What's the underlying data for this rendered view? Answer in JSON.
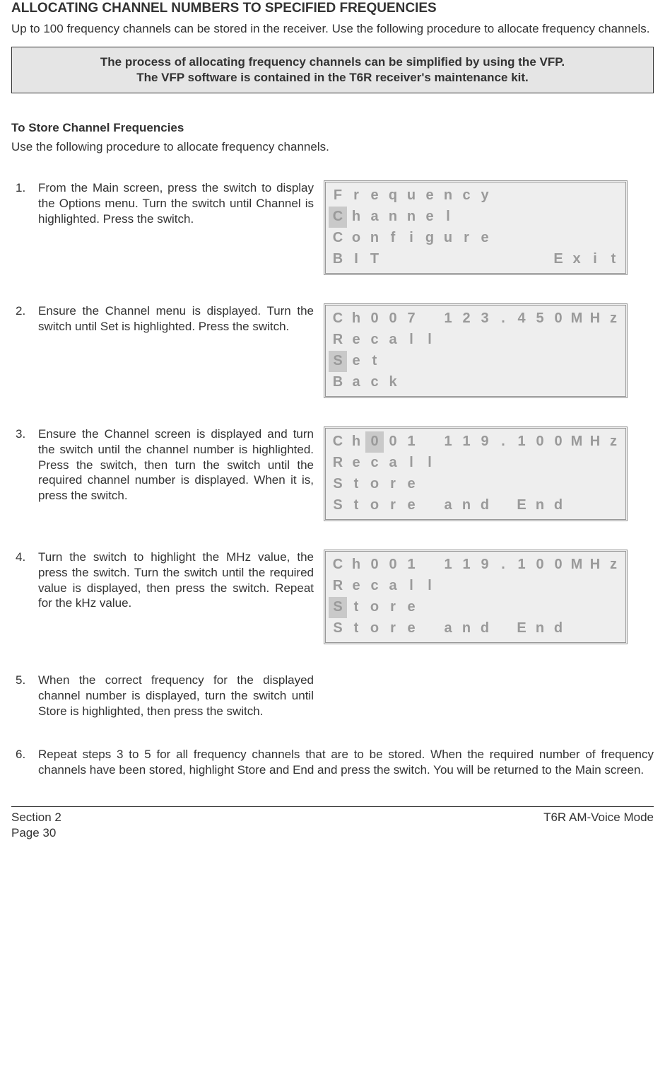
{
  "heading": "ALLOCATING CHANNEL NUMBERS TO SPECIFIED FREQUENCIES",
  "intro": "Up to 100 frequency channels can be stored in the receiver. Use the following procedure to allocate frequency channels.",
  "note": {
    "line1": "The process of allocating frequency channels can be simplified by using the VFP.",
    "line2": "The VFP software is contained in the T6R receiver's maintenance kit."
  },
  "sub_heading": "To Store Channel Frequencies",
  "sub_text": "Use the following procedure to allocate frequency channels.",
  "steps": [
    {
      "text": "From the Main screen, press the switch to display the Options menu. Turn the switch until Channel is highlighted. Press the switch.",
      "lcd": [
        {
          "cells": [
            {
              "c": "F"
            },
            {
              "c": "r"
            },
            {
              "c": "e"
            },
            {
              "c": "q"
            },
            {
              "c": "u"
            },
            {
              "c": "e"
            },
            {
              "c": "n"
            },
            {
              "c": "c"
            },
            {
              "c": "y"
            },
            {
              "c": ""
            },
            {
              "c": ""
            },
            {
              "c": ""
            },
            {
              "c": ""
            },
            {
              "c": ""
            },
            {
              "c": ""
            },
            {
              "c": ""
            }
          ]
        },
        {
          "cells": [
            {
              "c": "C",
              "hl": true
            },
            {
              "c": "h"
            },
            {
              "c": "a"
            },
            {
              "c": "n"
            },
            {
              "c": "n"
            },
            {
              "c": "e"
            },
            {
              "c": "l"
            },
            {
              "c": ""
            },
            {
              "c": ""
            },
            {
              "c": ""
            },
            {
              "c": ""
            },
            {
              "c": ""
            },
            {
              "c": ""
            },
            {
              "c": ""
            },
            {
              "c": ""
            },
            {
              "c": ""
            }
          ]
        },
        {
          "cells": [
            {
              "c": "C"
            },
            {
              "c": "o"
            },
            {
              "c": "n"
            },
            {
              "c": "f"
            },
            {
              "c": "i"
            },
            {
              "c": "g"
            },
            {
              "c": "u"
            },
            {
              "c": "r"
            },
            {
              "c": "e"
            },
            {
              "c": ""
            },
            {
              "c": ""
            },
            {
              "c": ""
            },
            {
              "c": ""
            },
            {
              "c": ""
            },
            {
              "c": ""
            },
            {
              "c": ""
            }
          ]
        },
        {
          "cells": [
            {
              "c": "B"
            },
            {
              "c": "I"
            },
            {
              "c": "T"
            },
            {
              "c": ""
            },
            {
              "c": ""
            },
            {
              "c": ""
            },
            {
              "c": ""
            },
            {
              "c": ""
            },
            {
              "c": ""
            },
            {
              "c": ""
            },
            {
              "c": ""
            },
            {
              "c": ""
            },
            {
              "c": "E"
            },
            {
              "c": "x"
            },
            {
              "c": "i"
            },
            {
              "c": "t"
            }
          ]
        }
      ]
    },
    {
      "text": "Ensure the Channel menu is displayed. Turn the switch until Set is highlighted. Press the switch.",
      "lcd": [
        {
          "cells": [
            {
              "c": "C"
            },
            {
              "c": "h"
            },
            {
              "c": "0"
            },
            {
              "c": "0"
            },
            {
              "c": "7"
            },
            {
              "c": ""
            },
            {
              "c": "1"
            },
            {
              "c": "2"
            },
            {
              "c": "3"
            },
            {
              "c": "."
            },
            {
              "c": "4"
            },
            {
              "c": "5"
            },
            {
              "c": "0"
            },
            {
              "c": "M"
            },
            {
              "c": "H"
            },
            {
              "c": "z"
            }
          ]
        },
        {
          "cells": [
            {
              "c": "R"
            },
            {
              "c": "e"
            },
            {
              "c": "c"
            },
            {
              "c": "a"
            },
            {
              "c": "l"
            },
            {
              "c": "l"
            },
            {
              "c": ""
            },
            {
              "c": ""
            },
            {
              "c": ""
            },
            {
              "c": ""
            },
            {
              "c": ""
            },
            {
              "c": ""
            },
            {
              "c": ""
            },
            {
              "c": ""
            },
            {
              "c": ""
            },
            {
              "c": ""
            }
          ]
        },
        {
          "cells": [
            {
              "c": "S",
              "hl": true
            },
            {
              "c": "e"
            },
            {
              "c": "t"
            },
            {
              "c": ""
            },
            {
              "c": ""
            },
            {
              "c": ""
            },
            {
              "c": ""
            },
            {
              "c": ""
            },
            {
              "c": ""
            },
            {
              "c": ""
            },
            {
              "c": ""
            },
            {
              "c": ""
            },
            {
              "c": ""
            },
            {
              "c": ""
            },
            {
              "c": ""
            },
            {
              "c": ""
            }
          ]
        },
        {
          "cells": [
            {
              "c": "B"
            },
            {
              "c": "a"
            },
            {
              "c": "c"
            },
            {
              "c": "k"
            },
            {
              "c": ""
            },
            {
              "c": ""
            },
            {
              "c": ""
            },
            {
              "c": ""
            },
            {
              "c": ""
            },
            {
              "c": ""
            },
            {
              "c": ""
            },
            {
              "c": ""
            },
            {
              "c": ""
            },
            {
              "c": ""
            },
            {
              "c": ""
            },
            {
              "c": ""
            }
          ]
        }
      ]
    },
    {
      "text": "Ensure the Channel screen is displayed and turn the switch until the channel number is highlighted. Press the switch, then turn the switch until the required channel number is displayed. When it is, press the switch.",
      "lcd": [
        {
          "cells": [
            {
              "c": "C"
            },
            {
              "c": "h"
            },
            {
              "c": "0",
              "hl": true
            },
            {
              "c": "0"
            },
            {
              "c": "1"
            },
            {
              "c": ""
            },
            {
              "c": "1"
            },
            {
              "c": "1"
            },
            {
              "c": "9"
            },
            {
              "c": "."
            },
            {
              "c": "1"
            },
            {
              "c": "0"
            },
            {
              "c": "0"
            },
            {
              "c": "M"
            },
            {
              "c": "H"
            },
            {
              "c": "z"
            }
          ]
        },
        {
          "cells": [
            {
              "c": "R"
            },
            {
              "c": "e"
            },
            {
              "c": "c"
            },
            {
              "c": "a"
            },
            {
              "c": "l"
            },
            {
              "c": "l"
            },
            {
              "c": ""
            },
            {
              "c": ""
            },
            {
              "c": ""
            },
            {
              "c": ""
            },
            {
              "c": ""
            },
            {
              "c": ""
            },
            {
              "c": ""
            },
            {
              "c": ""
            },
            {
              "c": ""
            },
            {
              "c": ""
            }
          ]
        },
        {
          "cells": [
            {
              "c": "S"
            },
            {
              "c": "t"
            },
            {
              "c": "o"
            },
            {
              "c": "r"
            },
            {
              "c": "e"
            },
            {
              "c": ""
            },
            {
              "c": ""
            },
            {
              "c": ""
            },
            {
              "c": ""
            },
            {
              "c": ""
            },
            {
              "c": ""
            },
            {
              "c": ""
            },
            {
              "c": ""
            },
            {
              "c": ""
            },
            {
              "c": ""
            },
            {
              "c": ""
            }
          ]
        },
        {
          "cells": [
            {
              "c": "S"
            },
            {
              "c": "t"
            },
            {
              "c": "o"
            },
            {
              "c": "r"
            },
            {
              "c": "e"
            },
            {
              "c": ""
            },
            {
              "c": "a"
            },
            {
              "c": "n"
            },
            {
              "c": "d"
            },
            {
              "c": ""
            },
            {
              "c": "E"
            },
            {
              "c": "n"
            },
            {
              "c": "d"
            },
            {
              "c": ""
            },
            {
              "c": ""
            },
            {
              "c": ""
            }
          ]
        }
      ]
    },
    {
      "text": "Turn the switch to highlight the MHz value, the press the switch. Turn the switch until the required value is displayed, then press the switch. Repeat for the kHz value.",
      "lcd": [
        {
          "cells": [
            {
              "c": "C"
            },
            {
              "c": "h"
            },
            {
              "c": "0"
            },
            {
              "c": "0"
            },
            {
              "c": "1"
            },
            {
              "c": ""
            },
            {
              "c": "1"
            },
            {
              "c": "1"
            },
            {
              "c": "9"
            },
            {
              "c": "."
            },
            {
              "c": "1"
            },
            {
              "c": "0"
            },
            {
              "c": "0"
            },
            {
              "c": "M"
            },
            {
              "c": "H"
            },
            {
              "c": "z"
            }
          ]
        },
        {
          "cells": [
            {
              "c": "R"
            },
            {
              "c": "e"
            },
            {
              "c": "c"
            },
            {
              "c": "a"
            },
            {
              "c": "l"
            },
            {
              "c": "l"
            },
            {
              "c": ""
            },
            {
              "c": ""
            },
            {
              "c": ""
            },
            {
              "c": ""
            },
            {
              "c": ""
            },
            {
              "c": ""
            },
            {
              "c": ""
            },
            {
              "c": ""
            },
            {
              "c": ""
            },
            {
              "c": ""
            }
          ]
        },
        {
          "cells": [
            {
              "c": "S",
              "hl": true
            },
            {
              "c": "t"
            },
            {
              "c": "o"
            },
            {
              "c": "r"
            },
            {
              "c": "e"
            },
            {
              "c": ""
            },
            {
              "c": ""
            },
            {
              "c": ""
            },
            {
              "c": ""
            },
            {
              "c": ""
            },
            {
              "c": ""
            },
            {
              "c": ""
            },
            {
              "c": ""
            },
            {
              "c": ""
            },
            {
              "c": ""
            },
            {
              "c": ""
            }
          ]
        },
        {
          "cells": [
            {
              "c": "S"
            },
            {
              "c": "t"
            },
            {
              "c": "o"
            },
            {
              "c": "r"
            },
            {
              "c": "e"
            },
            {
              "c": ""
            },
            {
              "c": "a"
            },
            {
              "c": "n"
            },
            {
              "c": "d"
            },
            {
              "c": ""
            },
            {
              "c": "E"
            },
            {
              "c": "n"
            },
            {
              "c": "d"
            },
            {
              "c": ""
            },
            {
              "c": ""
            },
            {
              "c": ""
            }
          ]
        }
      ]
    },
    {
      "text": "When the correct frequency for the displayed channel number is displayed, turn the switch until Store is highlighted, then press the switch."
    },
    {
      "text": "Repeat steps 3 to 5 for all frequency channels that are to be stored. When the required number of frequency channels have been stored, highlight Store and End and press the switch. You will be returned to the Main screen.",
      "wide": true
    }
  ],
  "footer": {
    "left1": "Section 2",
    "left2": "Page 30",
    "right": "T6R AM-Voice Mode"
  }
}
